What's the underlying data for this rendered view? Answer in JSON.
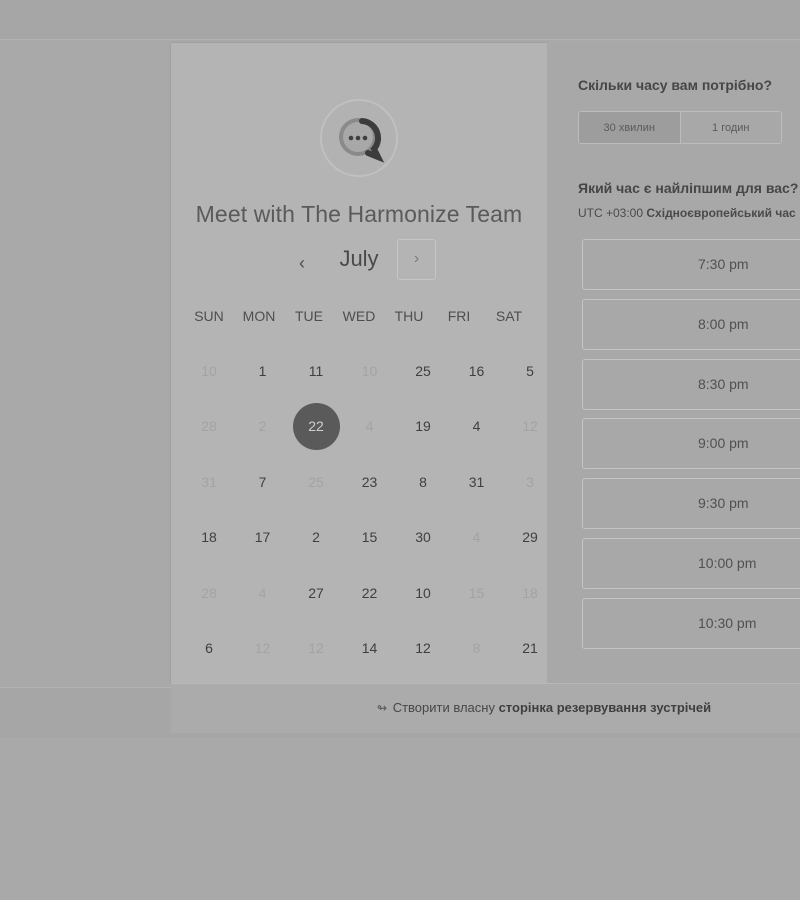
{
  "calendar": {
    "title": "Meet with The Harmonize Team",
    "month": "July",
    "prev_label": "‹",
    "next_label": "›",
    "weekdays": [
      "SUN",
      "MON",
      "TUE",
      "WED",
      "THU",
      "FRI",
      "SAT"
    ],
    "days": [
      {
        "d": "10",
        "s": "disabled"
      },
      {
        "d": "1",
        "s": "enabled"
      },
      {
        "d": "11",
        "s": "enabled"
      },
      {
        "d": "10",
        "s": "disabled"
      },
      {
        "d": "25",
        "s": "enabled"
      },
      {
        "d": "16",
        "s": "enabled"
      },
      {
        "d": "5",
        "s": "enabled"
      },
      {
        "d": "28",
        "s": "disabled"
      },
      {
        "d": "2",
        "s": "disabled"
      },
      {
        "d": "22",
        "s": "selected"
      },
      {
        "d": "4",
        "s": "disabled"
      },
      {
        "d": "19",
        "s": "enabled"
      },
      {
        "d": "4",
        "s": "enabled"
      },
      {
        "d": "12",
        "s": "disabled"
      },
      {
        "d": "31",
        "s": "disabled"
      },
      {
        "d": "7",
        "s": "enabled"
      },
      {
        "d": "25",
        "s": "disabled"
      },
      {
        "d": "23",
        "s": "enabled"
      },
      {
        "d": "8",
        "s": "enabled"
      },
      {
        "d": "31",
        "s": "enabled"
      },
      {
        "d": "3",
        "s": "disabled"
      },
      {
        "d": "18",
        "s": "enabled"
      },
      {
        "d": "17",
        "s": "enabled"
      },
      {
        "d": "2",
        "s": "enabled"
      },
      {
        "d": "15",
        "s": "enabled"
      },
      {
        "d": "30",
        "s": "enabled"
      },
      {
        "d": "4",
        "s": "disabled"
      },
      {
        "d": "29",
        "s": "enabled"
      },
      {
        "d": "28",
        "s": "disabled"
      },
      {
        "d": "4",
        "s": "disabled"
      },
      {
        "d": "27",
        "s": "enabled"
      },
      {
        "d": "22",
        "s": "enabled"
      },
      {
        "d": "10",
        "s": "enabled"
      },
      {
        "d": "15",
        "s": "disabled"
      },
      {
        "d": "18",
        "s": "disabled"
      },
      {
        "d": "6",
        "s": "enabled"
      },
      {
        "d": "12",
        "s": "disabled"
      },
      {
        "d": "12",
        "s": "disabled"
      },
      {
        "d": "14",
        "s": "enabled"
      },
      {
        "d": "12",
        "s": "enabled"
      },
      {
        "d": "8",
        "s": "disabled"
      },
      {
        "d": "21",
        "s": "enabled"
      }
    ]
  },
  "duration": {
    "question": "Скільки часу вам потрібно?",
    "options": [
      "30 хвилин",
      "1 годин"
    ],
    "selected": "30 хвилин"
  },
  "times": {
    "question": "Який час є найліпшим для вас?",
    "tz_offset": "UTC +03:00",
    "tz_name": "Східноєвропейський час",
    "slots": [
      "7:30 pm",
      "8:00 pm",
      "8:30 pm",
      "9:00 pm",
      "9:30 pm",
      "10:00 pm",
      "10:30 pm"
    ]
  },
  "footer": {
    "icon": "hubspot-sprocket-icon",
    "text_prefix": "Створити власну",
    "text_bold": "сторінка резервування зустрічей"
  },
  "colors": {
    "selected_day_bg": "#5a5a5a",
    "overlay": "#a9a9a9"
  }
}
